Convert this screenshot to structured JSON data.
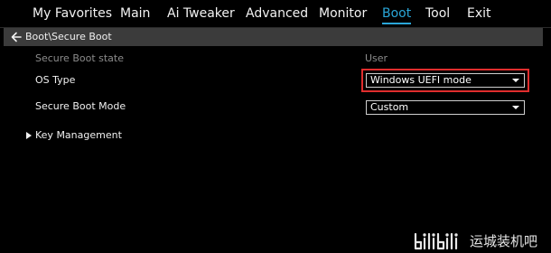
{
  "menu": {
    "items": [
      {
        "label": "My Favorites",
        "active": false
      },
      {
        "label": "Main",
        "active": false
      },
      {
        "label": "Ai Tweaker",
        "active": false
      },
      {
        "label": "Advanced",
        "active": false
      },
      {
        "label": "Monitor",
        "active": false
      },
      {
        "label": "Boot",
        "active": true
      },
      {
        "label": "Tool",
        "active": false
      },
      {
        "label": "Exit",
        "active": false
      }
    ]
  },
  "breadcrumb": {
    "path": "Boot\\Secure Boot",
    "back_icon": "back-arrow-icon"
  },
  "settings": {
    "secure_boot_state": {
      "label": "Secure Boot state",
      "value": "User"
    },
    "os_type": {
      "label": "OS Type",
      "value": "Windows UEFI mode",
      "highlighted": true
    },
    "secure_boot_mode": {
      "label": "Secure Boot Mode",
      "value": "Custom"
    },
    "key_management": {
      "label": "Key Management",
      "icon": "submenu-arrow-icon"
    }
  },
  "watermark": {
    "logo": "bilibili",
    "text": "运城装机吧"
  },
  "colors": {
    "background": "#000000",
    "active_tab": "#2aa6d8",
    "breadcrumb_bar": "#3b3b3b",
    "highlight": "#e02d2d",
    "dim_text": "#8c8c8c"
  }
}
